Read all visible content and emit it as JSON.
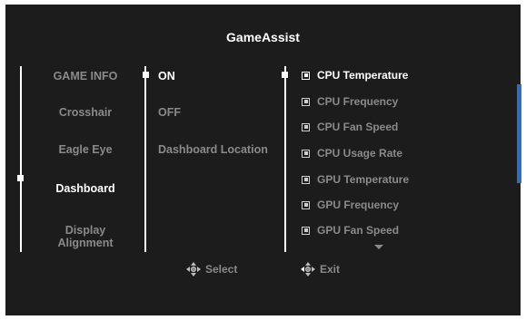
{
  "title": "GameAssist",
  "menu": {
    "items": [
      {
        "label": "GAME INFO",
        "selected": false
      },
      {
        "label": "Crosshair",
        "selected": false
      },
      {
        "label": "Eagle Eye",
        "selected": false
      },
      {
        "label": "Dashboard",
        "selected": true
      },
      {
        "label": "Display Alignment",
        "selected": false
      }
    ]
  },
  "submenu": {
    "items": [
      {
        "label": "ON",
        "selected": true
      },
      {
        "label": "OFF",
        "selected": false
      },
      {
        "label": "Dashboard Location",
        "selected": false
      }
    ]
  },
  "options": {
    "items": [
      {
        "label": "CPU Temperature",
        "checked": true,
        "highlighted": true
      },
      {
        "label": "CPU Frequency",
        "checked": true,
        "highlighted": false
      },
      {
        "label": "CPU Fan Speed",
        "checked": true,
        "highlighted": false
      },
      {
        "label": "CPU Usage Rate",
        "checked": true,
        "highlighted": false
      },
      {
        "label": "GPU Temperature",
        "checked": true,
        "highlighted": false
      },
      {
        "label": "GPU Frequency",
        "checked": true,
        "highlighted": false
      },
      {
        "label": "GPU Fan Speed",
        "checked": true,
        "highlighted": false
      }
    ],
    "more_indicator": "chevron-down-icon"
  },
  "footer": {
    "select_label": "Select",
    "exit_label": "Exit"
  },
  "colors": {
    "background": "#1c1c1c",
    "text_active": "#ffffff",
    "text_inactive": "#8a8a8a",
    "scrollbar": "#2b6fc4"
  }
}
